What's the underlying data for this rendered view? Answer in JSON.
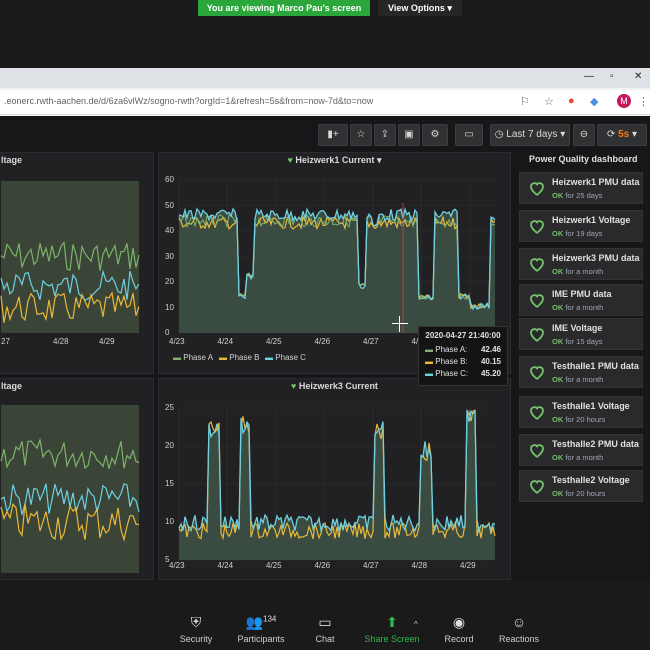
{
  "zoom": {
    "banner": "You are viewing Marco Pau's screen",
    "view_options": "View Options",
    "bottom": [
      {
        "label": "Security",
        "icon": "shield-icon"
      },
      {
        "label": "Participants",
        "icon": "participants-icon",
        "count": "134"
      },
      {
        "label": "Chat",
        "icon": "chat-icon"
      },
      {
        "label": "Share Screen",
        "icon": "share-screen-icon"
      },
      {
        "label": "Record",
        "icon": "record-icon"
      },
      {
        "label": "Reactions",
        "icon": "reactions-icon"
      }
    ]
  },
  "browser": {
    "url": ".eonerc.rwth-aachen.de/d/6za6vlWz/sogno-rwth?orgId=1&refresh=5s&from=now-7d&to=now",
    "avatar": "M"
  },
  "toolbar": {
    "time_range": "Last 7 days",
    "refresh": "5s"
  },
  "panels": {
    "top_left_title": "ltage",
    "bottom_left_title": "ltage",
    "hw1_title": "Heizwerk1 Current",
    "hw3_title": "Heizwerk3 Current",
    "top_left_x": [
      "27",
      "4/28",
      "4/29"
    ],
    "hw1_y": [
      "60",
      "50",
      "40",
      "30",
      "20",
      "10",
      "0"
    ],
    "hw1_x": [
      "4/23",
      "4/24",
      "4/25",
      "4/26",
      "4/27",
      "4/28",
      "4/29"
    ],
    "hw3_y": [
      "25",
      "20",
      "15",
      "10",
      "5"
    ],
    "hw3_x": [
      "4/23",
      "4/24",
      "4/25",
      "4/26",
      "4/27",
      "4/28",
      "4/29"
    ],
    "legend": [
      "Phase A",
      "Phase B",
      "Phase C"
    ]
  },
  "colors": {
    "phase_a": "#7eb26d",
    "phase_b": "#eab839",
    "phase_c": "#6ed0e0",
    "ok": "#73bf69"
  },
  "tooltip": {
    "time": "2020-04-27 21:40:00",
    "rows": [
      {
        "label": "Phase A:",
        "value": "42.46"
      },
      {
        "label": "Phase B:",
        "value": "40.15"
      },
      {
        "label": "Phase C:",
        "value": "45.20"
      }
    ]
  },
  "status": {
    "title": "Power Quality dashboard",
    "items": [
      {
        "name": "Heizwerk1 PMU data",
        "ok": "OK",
        "since": "for 25 days"
      },
      {
        "name": "Heizwerk1 Voltage",
        "ok": "OK",
        "since": "for 19 days"
      },
      {
        "name": "Heizwerk3 PMU data",
        "ok": "OK",
        "since": "for a month"
      },
      {
        "name": "IME PMU data",
        "ok": "OK",
        "since": "for a month"
      },
      {
        "name": "IME Voltage",
        "ok": "OK",
        "since": "for 15 days"
      },
      {
        "name": "Testhalle1 PMU data",
        "ok": "OK",
        "since": "for a month"
      },
      {
        "name": "Testhalle1 Voltage",
        "ok": "OK",
        "since": "for 20 hours"
      },
      {
        "name": "Testhalle2 PMU data",
        "ok": "OK",
        "since": "for a month"
      },
      {
        "name": "Testhalle2 Voltage",
        "ok": "OK",
        "since": "for 20 hours"
      }
    ]
  }
}
